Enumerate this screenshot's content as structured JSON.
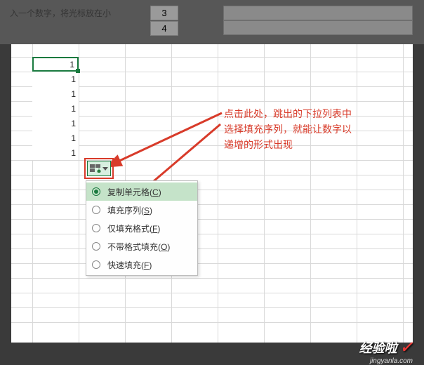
{
  "top_hint": "入一个数字，将光标放在小",
  "top_rows": [
    "3",
    "4"
  ],
  "cells": [
    "1",
    "1",
    "1",
    "1",
    "1",
    "1",
    "1"
  ],
  "dropdown": {
    "items": [
      {
        "label": "复制单元格",
        "hotkey": "C",
        "selected": true
      },
      {
        "label": "填充序列",
        "hotkey": "S",
        "selected": false
      },
      {
        "label": "仅填充格式",
        "hotkey": "F",
        "selected": false
      },
      {
        "label": "不带格式填充",
        "hotkey": "O",
        "selected": false
      },
      {
        "label": "快速填充",
        "hotkey": "F",
        "selected": false
      }
    ]
  },
  "annotation": {
    "line1": "点击此处，跳出的下拉列表中",
    "line2": "选择填充序列，就能让数字以",
    "line3": "递增的形式出现"
  },
  "watermark": {
    "brand": "经验啦",
    "url": "jingyanla.com"
  },
  "chart_data": null
}
